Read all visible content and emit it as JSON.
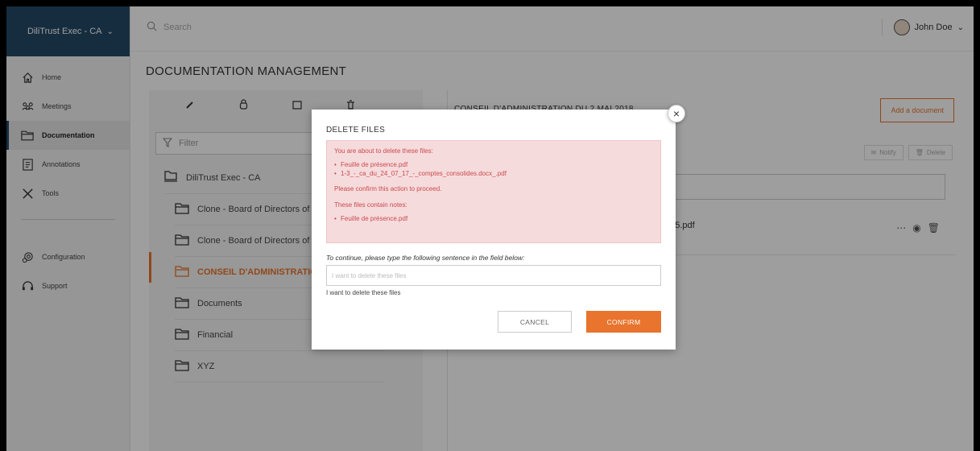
{
  "brand": {
    "name": "DiliTrust Exec - CA"
  },
  "search": {
    "placeholder": "Search"
  },
  "user": {
    "name": "John Doe"
  },
  "sidebar": {
    "items": [
      {
        "label": "Home",
        "icon": "home-icon"
      },
      {
        "label": "Meetings",
        "icon": "meetings-icon"
      },
      {
        "label": "Documentation",
        "icon": "folder-icon",
        "active": true
      },
      {
        "label": "Annotations",
        "icon": "annotations-icon"
      },
      {
        "label": "Tools",
        "icon": "tools-icon"
      }
    ],
    "secondary": [
      {
        "label": "Configuration",
        "icon": "gear-icon"
      },
      {
        "label": "Support",
        "icon": "headset-icon"
      }
    ]
  },
  "page": {
    "title": "DOCUMENTATION MANAGEMENT"
  },
  "tree": {
    "filter_placeholder": "Filter",
    "root": "DiliTrust Exec - CA",
    "items": [
      "Clone - Board of Directors of",
      "Clone - Board of Directors of",
      "CONSEIL D'ADMINISTRATIO",
      "Documents",
      "Financial",
      "XYZ"
    ],
    "selected_index": 2
  },
  "detail": {
    "title": "CONSEIL D'ADMINISTRATION DU 2 MAI 2018",
    "add_document": "Add a document",
    "notify": "Notify",
    "delete": "Delete",
    "doc_name": "015.pdf"
  },
  "modal": {
    "title": "DELETE FILES",
    "intro": "You are about to delete these files:",
    "files": [
      "Feuille de présence.pdf",
      "1-3_-_ca_du_24_07_17_-_comptes_consolides.docx_.pdf"
    ],
    "confirm_msg": "Please confirm this action to proceed.",
    "notes_msg": "These files contain notes:",
    "notes_files": [
      "Feuille de présence.pdf"
    ],
    "instruction": "To continue, please type the following sentence in the field below:",
    "input_placeholder": "I want to delete these files",
    "hint": "I want to delete these files",
    "cancel": "CANCEL",
    "confirm": "CONFIRM"
  },
  "colors": {
    "brand": "#254a67",
    "accent": "#e8742d",
    "alert_bg": "#f6dbdc",
    "alert_text": "#c94a4e"
  }
}
